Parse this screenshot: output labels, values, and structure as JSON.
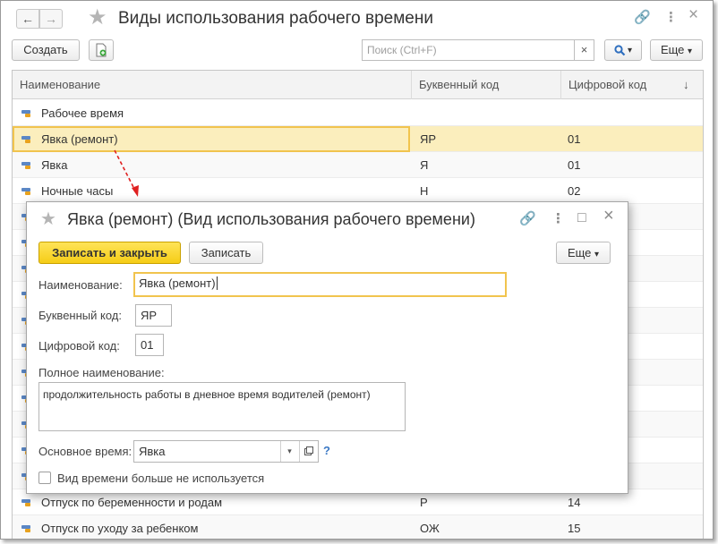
{
  "window": {
    "title": "Виды использования рабочего времени",
    "back_icon": "←",
    "forward_icon": "→",
    "star_icon": "★",
    "link_icon": "🔗",
    "menu_icon": "⋮",
    "close_icon": "×"
  },
  "toolbar": {
    "create_label": "Создать",
    "search_placeholder": "Поиск (Ctrl+F)",
    "clear_icon": "×",
    "search_icon": "🔍",
    "more_label": "Еще",
    "dropdown_icon": "▾"
  },
  "table": {
    "headers": {
      "name": "Наименование",
      "letter": "Буквенный код",
      "digit": "Цифровой код",
      "sort_icon": "↓"
    },
    "rows_top": [
      {
        "name": "Рабочее время",
        "letter": "",
        "digit": ""
      },
      {
        "name": "Явка (ремонт)",
        "letter": "ЯР",
        "digit": "01"
      },
      {
        "name": "Явка",
        "letter": "Я",
        "digit": "01"
      },
      {
        "name": "Ночные часы",
        "letter": "Н",
        "digit": "02"
      }
    ],
    "rows_bottom": [
      {
        "name": "Отпуск по беременности и родам",
        "letter": "Р",
        "digit": "14"
      },
      {
        "name": "Отпуск по уходу за ребенком",
        "letter": "ОЖ",
        "digit": "15"
      }
    ]
  },
  "dialog": {
    "title": "Явка (ремонт) (Вид использования рабочего времени)",
    "save_close_label": "Записать и закрыть",
    "save_label": "Записать",
    "more_label": "Еще",
    "name_label": "Наименование:",
    "name_value": "Явка (ремонт)",
    "letter_label": "Буквенный код:",
    "letter_value": "ЯР",
    "digit_label": "Цифровой код:",
    "digit_value": "01",
    "full_name_label": "Полное наименование:",
    "full_name_value": "продолжительность работы в дневное время водителей (ремонт)",
    "main_time_label": "Основное время:",
    "main_time_value": "Явка",
    "help_icon": "?",
    "not_used_label": "Вид времени больше не используется",
    "maximize_icon": "□"
  },
  "colors": {
    "accent_yellow": "#f5cd17",
    "selection": "#fbeebd",
    "focus_border": "#f1c44e",
    "arrow": "#e02020"
  }
}
